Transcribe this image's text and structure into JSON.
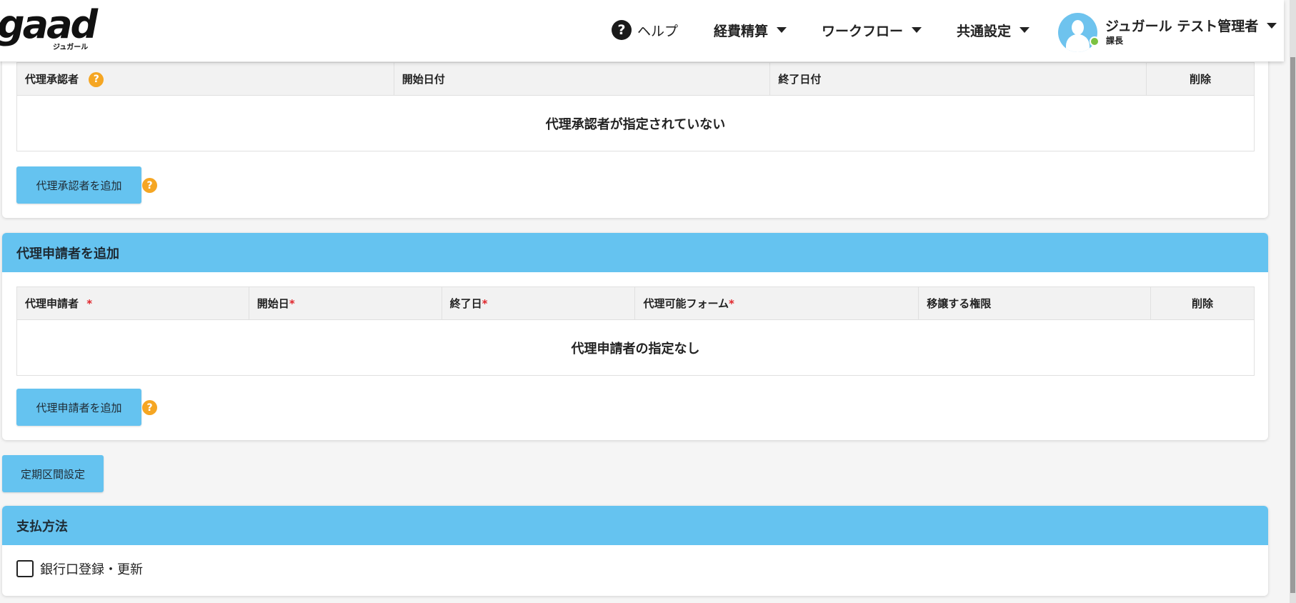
{
  "header": {
    "logo": "gaad",
    "logo_sub": "ジュガール",
    "nav": {
      "help": "ヘルプ",
      "expense": "経費精算",
      "workflow": "ワークフロー",
      "common": "共通設定"
    },
    "user": {
      "name": "ジュガール テスト管理者",
      "role": "課長"
    }
  },
  "proxy_approver": {
    "columns": {
      "approver": "代理承認者",
      "start": "開始日付",
      "end": "終了日付",
      "delete": "削除"
    },
    "empty_message": "代理承認者が指定されていない",
    "add_button": "代理承認者を追加"
  },
  "proxy_applicant": {
    "title": "代理申請者を追加",
    "columns": {
      "applicant": "代理申請者",
      "start": "開始日",
      "end": "終了日",
      "forms": "代理可能フォーム",
      "transfer": "移譲する権限",
      "delete": "削除"
    },
    "required_mark": "*",
    "empty_message": "代理申請者の指定なし",
    "add_button": "代理申請者を追加"
  },
  "commute_button": "定期区間設定",
  "payment": {
    "title": "支払方法",
    "bank_checkbox_label": "銀行口登録・更新"
  },
  "icons": {
    "help": "?",
    "question": "?"
  },
  "colors": {
    "accent": "#65c3f0",
    "question_icon": "#f5a623",
    "required": "#e0262c",
    "online": "#7cc242"
  }
}
